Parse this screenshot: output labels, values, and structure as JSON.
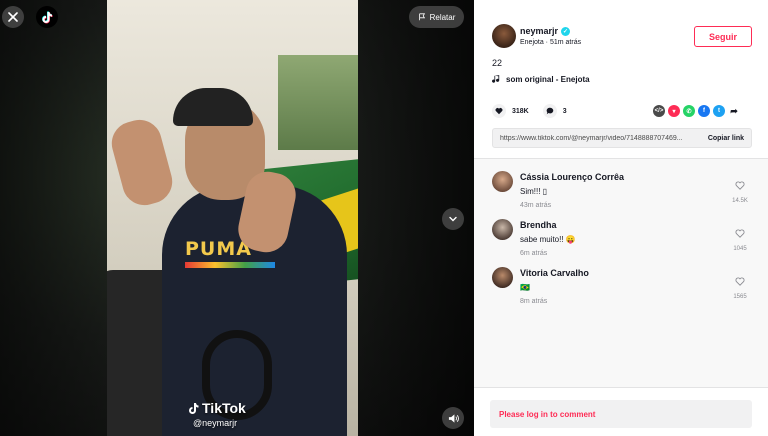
{
  "player": {
    "report_label": "Relatar",
    "watermark_brand": "TikTok",
    "watermark_user": "@neymarjr",
    "video_print": "PUMA"
  },
  "author": {
    "username": "neymarjr",
    "subtitle": "Enejota · 51m atrás",
    "follow_label": "Seguir"
  },
  "post": {
    "caption": "22",
    "music": "som original - Enejota"
  },
  "actions": {
    "likes": "318K",
    "comments": "3"
  },
  "link": {
    "url": "https://www.tiktok.com/@neymarjr/video/7148888707469...",
    "copy_label": "Copiar link"
  },
  "comments": [
    {
      "name": "Cássia Lourenço Corrêa",
      "text": "Sim!!! ▯",
      "time": "43m atrás",
      "likes": "14.5K"
    },
    {
      "name": "Brendha",
      "text": "sabe muito!! 😛",
      "time": "6m atrás",
      "likes": "1045"
    },
    {
      "name": "Vitoria Carvalho",
      "text": "🇧🇷",
      "time": "8m atrás",
      "likes": "1565"
    }
  ],
  "login_prompt": "Please log in to comment",
  "colors": {
    "accent": "#fe2c55",
    "verified": "#20d5ec",
    "share_embed": "#4a4a4a",
    "share_pink": "#fe2c55",
    "share_whatsapp": "#25d366",
    "share_facebook": "#1877f2",
    "share_twitter": "#1da1f2"
  },
  "icons": {
    "close": "close-icon",
    "logo": "tiktok-logo-icon",
    "report": "flag-icon",
    "next": "chevron-down-icon",
    "volume": "volume-icon",
    "music": "music-note-icon",
    "like": "heart-icon",
    "comment": "comment-icon"
  }
}
